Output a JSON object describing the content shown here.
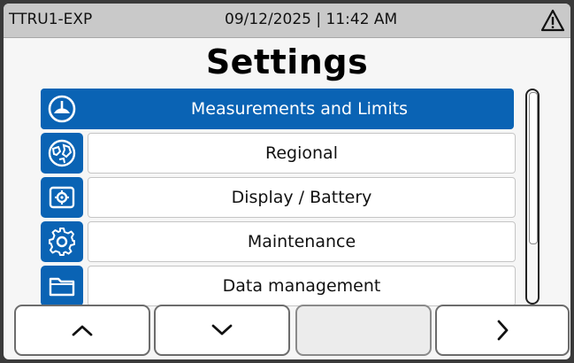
{
  "header": {
    "device_id": "TTRU1-EXP",
    "datetime": "09/12/2025 | 11:42 AM",
    "warning_icon": "warning-triangle-icon"
  },
  "title": "Settings",
  "menu": {
    "items": [
      {
        "label": "Measurements and Limits",
        "icon": "gauge-icon",
        "selected": true
      },
      {
        "label": "Regional",
        "icon": "globe-icon",
        "selected": false
      },
      {
        "label": "Display / Battery",
        "icon": "display-settings-icon",
        "selected": false
      },
      {
        "label": "Maintenance",
        "icon": "gear-icon",
        "selected": false
      },
      {
        "label": "Data management",
        "icon": "folder-icon",
        "selected": false
      }
    ]
  },
  "scrollbar": {
    "visible_fraction": 0.7
  },
  "nav_buttons": [
    {
      "name": "up",
      "icon": "chevron-up-icon",
      "enabled": true
    },
    {
      "name": "down",
      "icon": "chevron-down-icon",
      "enabled": true
    },
    {
      "name": "blank",
      "icon": "",
      "enabled": false
    },
    {
      "name": "next",
      "icon": "chevron-right-icon",
      "enabled": true
    }
  ],
  "colors": {
    "accent": "#0a63b4",
    "header_bg": "#c9c9c9",
    "screen_bg": "#f6f6f6",
    "bezel": "#3a3a3a"
  }
}
